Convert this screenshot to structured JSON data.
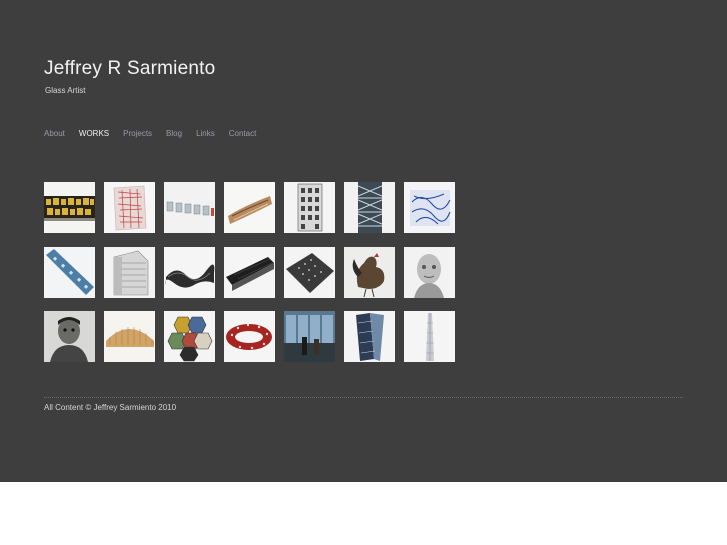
{
  "header": {
    "title": "Jeffrey R Sarmiento",
    "subtitle": "Glass Artist"
  },
  "nav": {
    "items": [
      {
        "label": "About",
        "active": false
      },
      {
        "label": "WORKS",
        "active": true
      },
      {
        "label": "Projects",
        "active": false
      },
      {
        "label": "Blog",
        "active": false
      },
      {
        "label": "Links",
        "active": false
      },
      {
        "label": "Contact",
        "active": false
      }
    ]
  },
  "gallery": {
    "rows": [
      [
        "gold-mosaic-slab-thumbnail",
        "red-glass-block-thumbnail",
        "small-glass-tiles-thumbnail",
        "curved-glass-thumbnail",
        "tall-building-panel-thumbnail",
        "bridge-panel-thumbnail",
        "blue-pattern-block-thumbnail"
      ],
      [
        "blue-building-bar-thumbnail",
        "building-facade-thumbnail",
        "dark-wave-panel-thumbnail",
        "dark-grid-slab-thumbnail",
        "folded-panel-thumbnail",
        "rooster-glass-thumbnail",
        "portrait-glass-thumbnail"
      ],
      [
        "man-portrait-thumbnail",
        "amber-dome-thumbnail",
        "hexagon-tiles-thumbnail",
        "red-ring-thumbnail",
        "window-view-thumbnail",
        "diagonal-panels-thumbnail",
        "spire-thumbnail"
      ]
    ]
  },
  "footer": {
    "text": "All Content © Jeffrey Sarmiento 2010"
  },
  "colors": {
    "background": "#3e3e3e",
    "nav_link": "#9a9aa8",
    "nav_active": "#f0f0f0"
  }
}
